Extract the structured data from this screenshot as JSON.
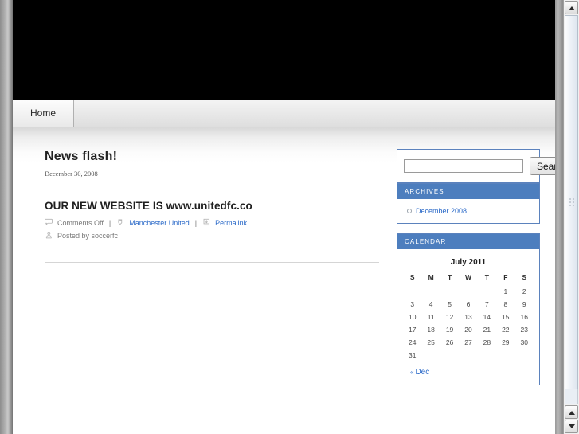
{
  "nav": {
    "tabs": [
      {
        "label": "Home"
      }
    ]
  },
  "post": {
    "title": "News flash!",
    "date": "December 30, 2008",
    "body_heading": "OUR NEW WEBSITE IS   www.unitedfc.co",
    "meta": {
      "comments_label": "Comments Off",
      "separator": "|",
      "category_label": "Manchester United",
      "permalink_label": "Permalink",
      "author_label": "Posted by soccerfc"
    }
  },
  "sidebar": {
    "search": {
      "value": "",
      "placeholder": "",
      "button_label": "Search"
    },
    "archives": {
      "title": "ARCHIVES",
      "items": [
        {
          "label": "December 2008"
        }
      ]
    },
    "calendar": {
      "title": "CALENDAR",
      "caption": "July 2011",
      "weekdays": [
        "S",
        "M",
        "T",
        "W",
        "T",
        "F",
        "S"
      ],
      "weeks": [
        [
          "",
          "",
          "",
          "",
          "",
          "1",
          "2"
        ],
        [
          "3",
          "4",
          "5",
          "6",
          "7",
          "8",
          "9"
        ],
        [
          "10",
          "11",
          "12",
          "13",
          "14",
          "15",
          "16"
        ],
        [
          "17",
          "18",
          "19",
          "20",
          "21",
          "22",
          "23"
        ],
        [
          "24",
          "25",
          "26",
          "27",
          "28",
          "29",
          "30"
        ],
        [
          "31",
          "",
          "",
          "",
          "",
          "",
          ""
        ]
      ],
      "prev_label": "Dec",
      "prev_chevron": "«"
    }
  },
  "colors": {
    "widget_header": "#4d7ebe",
    "widget_border": "#5b82bd",
    "link": "#2a69c8",
    "banner": "#000000"
  }
}
